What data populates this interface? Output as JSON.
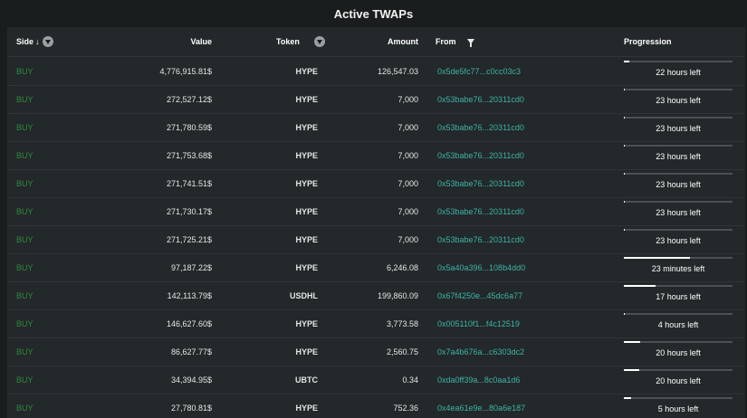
{
  "title": "Active TWAPs",
  "columns": {
    "side": "Side",
    "value": "Value",
    "token": "Token",
    "amount": "Amount",
    "from": "From",
    "progression": "Progression"
  },
  "rows": [
    {
      "side": "BUY",
      "value": "4,776,915.81$",
      "token": "HYPE",
      "amount": "126,547.03",
      "from": "0x5de5fc77...c0cc03c3",
      "progress_pct": 5,
      "time_left": "22 hours left"
    },
    {
      "side": "BUY",
      "value": "272,527.12$",
      "token": "HYPE",
      "amount": "7,000",
      "from": "0x53babe76...20311cd0",
      "progress_pct": 1,
      "time_left": "23 hours left"
    },
    {
      "side": "BUY",
      "value": "271,780.59$",
      "token": "HYPE",
      "amount": "7,000",
      "from": "0x53babe76...20311cd0",
      "progress_pct": 1,
      "time_left": "23 hours left"
    },
    {
      "side": "BUY",
      "value": "271,753.68$",
      "token": "HYPE",
      "amount": "7,000",
      "from": "0x53babe76...20311cd0",
      "progress_pct": 1,
      "time_left": "23 hours left"
    },
    {
      "side": "BUY",
      "value": "271,741.51$",
      "token": "HYPE",
      "amount": "7,000",
      "from": "0x53babe76...20311cd0",
      "progress_pct": 1,
      "time_left": "23 hours left"
    },
    {
      "side": "BUY",
      "value": "271,730.17$",
      "token": "HYPE",
      "amount": "7,000",
      "from": "0x53babe76...20311cd0",
      "progress_pct": 1,
      "time_left": "23 hours left"
    },
    {
      "side": "BUY",
      "value": "271,725.21$",
      "token": "HYPE",
      "amount": "7,000",
      "from": "0x53babe76...20311cd0",
      "progress_pct": 1,
      "time_left": "23 hours left"
    },
    {
      "side": "BUY",
      "value": "97,187.22$",
      "token": "HYPE",
      "amount": "6,246.08",
      "from": "0x5a40a396...108b4dd0",
      "progress_pct": 61,
      "time_left": "23 minutes left"
    },
    {
      "side": "BUY",
      "value": "142,113.79$",
      "token": "USDHL",
      "amount": "199,860.09",
      "from": "0x67f4250e...45dc6a77",
      "progress_pct": 29,
      "time_left": "17 hours left"
    },
    {
      "side": "BUY",
      "value": "146,627.60$",
      "token": "HYPE",
      "amount": "3,773.58",
      "from": "0x005110f1...f4c12519",
      "progress_pct": 1,
      "time_left": "4 hours left"
    },
    {
      "side": "BUY",
      "value": "86,627.77$",
      "token": "HYPE",
      "amount": "2,560.75",
      "from": "0x7a4b676a...c6303dc2",
      "progress_pct": 15,
      "time_left": "20 hours left"
    },
    {
      "side": "BUY",
      "value": "34,394.95$",
      "token": "UBTC",
      "amount": "0.34",
      "from": "0xda0ff39a...8c0aa1d6",
      "progress_pct": 14,
      "time_left": "20 hours left"
    },
    {
      "side": "BUY",
      "value": "27,780.81$",
      "token": "HYPE",
      "amount": "752.36",
      "from": "0x4ea61e9e...80a6e187",
      "progress_pct": 7,
      "time_left": "5 hours left"
    }
  ],
  "colors": {
    "buy": "#2e8b3e",
    "address": "#3fb3a6",
    "background": "#23282a"
  },
  "icons": {
    "sort": "sort-desc-icon",
    "filter": "filter-icon"
  }
}
